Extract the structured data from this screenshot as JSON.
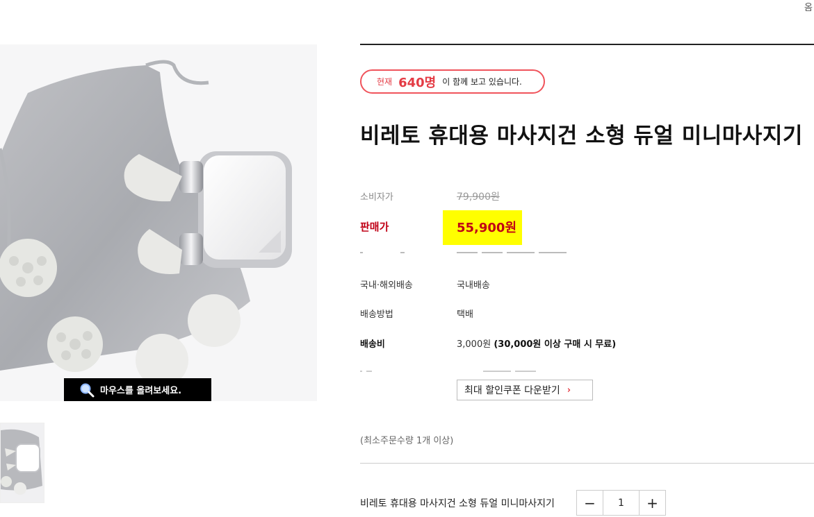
{
  "header": {
    "corner_text": "옴"
  },
  "gallery": {
    "zoom_hint": "마우스를 올려보세요."
  },
  "viewers": {
    "now_label": "현재",
    "count": "640명",
    "message": "이 함께 보고 있습니다."
  },
  "product": {
    "title": "비레토 휴대용 마사지건 소형 듀얼 미니마사지기"
  },
  "prices": {
    "consumer_label": "소비자가",
    "consumer_value": "79,900원",
    "sale_label": "판매가",
    "sale_value": "55,900원",
    "highlight_color": "#ffff00",
    "sale_color": "#c00016"
  },
  "shipping": {
    "domestic_label": "국내·해외배송",
    "domestic_value": "국내배송",
    "method_label": "배송방법",
    "method_value": "택배",
    "fee_label": "배송비",
    "fee_amount": "3,000원",
    "fee_condition": "(30,000원 이상 구매 시 무료)"
  },
  "coupon": {
    "label": "최대 할인쿠폰 다운받기",
    "chevron": "›"
  },
  "order": {
    "min_order": "(최소주문수량 1개 이상)",
    "option_name": "비레토 휴대용 마사지건 소형 듀얼 미니마사지기",
    "quantity": "1",
    "minus": "−",
    "plus": "+"
  },
  "icons": {
    "zoom": "magnifier-icon",
    "chevron": "chevron-right-icon"
  },
  "colors": {
    "accent_red": "#e43b44",
    "border_red": "#f0535b"
  }
}
